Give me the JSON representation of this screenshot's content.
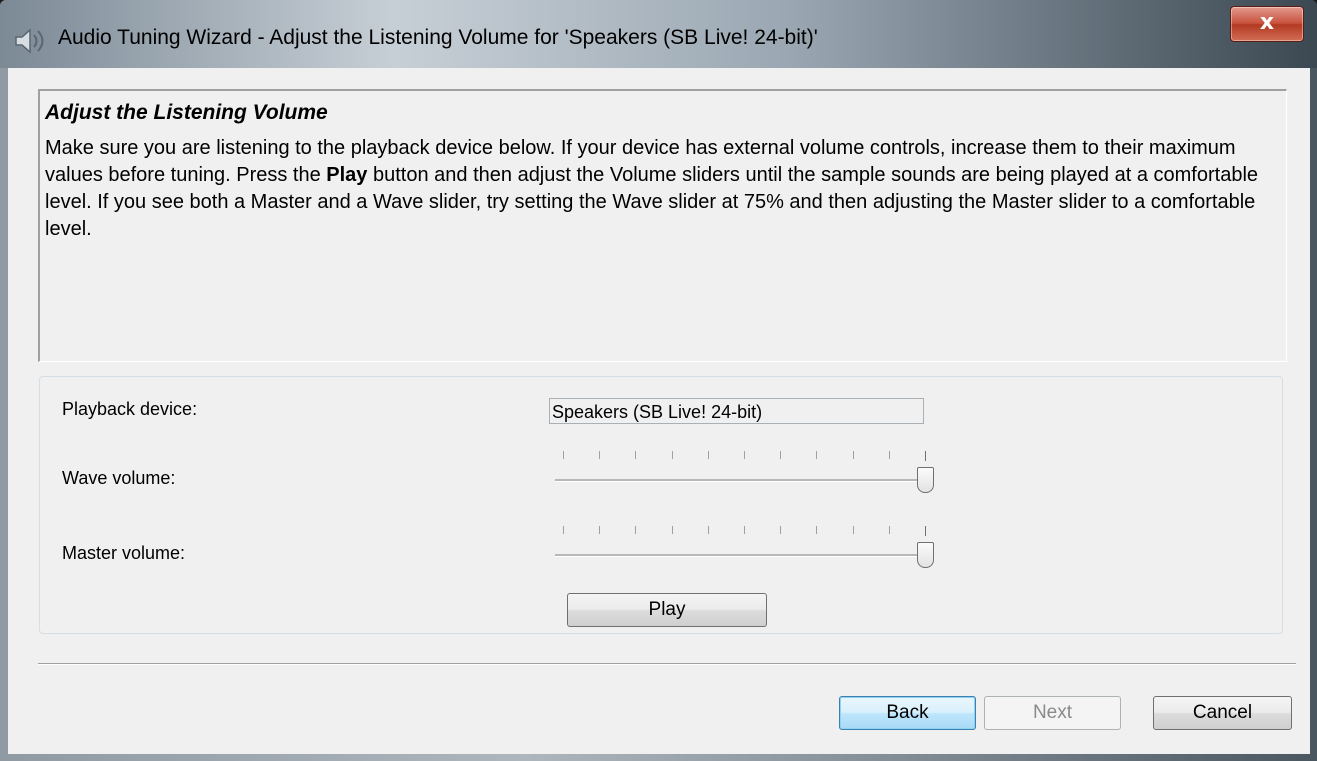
{
  "window": {
    "title": "Audio Tuning Wizard - Adjust the Listening Volume for 'Speakers (SB Live! 24-bit)'",
    "close_label": "x"
  },
  "info": {
    "title": "Adjust the Listening Volume",
    "body_part1": "Make sure you are listening to the playback device below. If your device has external volume controls, increase them to their maximum values before tuning. Press the ",
    "body_bold": "Play",
    "body_part2": " button and then adjust the Volume sliders until the sample sounds are being played at a comfortable level. If you see both a Master and a Wave slider, try setting the Wave slider at 75% and then adjusting the Master slider to a comfortable level."
  },
  "settings": {
    "playback_label": "Playback device:",
    "playback_value": "Speakers (SB Live! 24-bit)",
    "wave_label": "Wave volume:",
    "wave_level": 1.0,
    "master_label": "Master volume:",
    "master_level": 1.0,
    "play_label": "Play"
  },
  "footer": {
    "back_label": "Back",
    "next_label": "Next",
    "cancel_label": "Cancel"
  },
  "icons": {
    "title": "speaker-icon",
    "close": "close-icon"
  }
}
